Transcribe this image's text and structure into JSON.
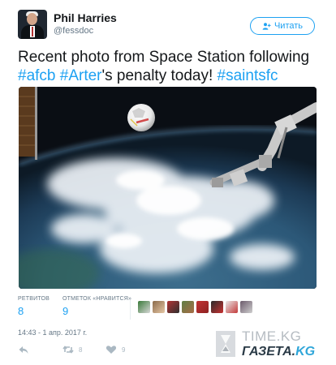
{
  "tweet": {
    "author_name": "Phil Harries",
    "author_handle": "@fessdoc",
    "follow_label": "Читать",
    "text_parts": {
      "p1": "Recent photo from Space Station following",
      "h1": "#afcb",
      "h2": "#Arter",
      "p2": "'s penalty today!",
      "h3": "#saintsfc"
    },
    "stats": {
      "retweets_label": "РЕТВИТОВ",
      "retweets_count": "8",
      "likes_label": "ОТМЕТОК «НРАВИТСЯ»",
      "likes_count": "9"
    },
    "timestamp": "14:43 - 1 апр. 2017 г.",
    "actions": {
      "retweet_count": "8",
      "like_count": "9"
    }
  },
  "watermark": {
    "site_top": "TIME.KG",
    "site_bottom_main": "ГАЗЕТА.",
    "site_bottom_tail": "KG"
  },
  "colors": {
    "accent": "#1da1f2",
    "muted": "#657786",
    "icon_gray": "#aab8c2"
  },
  "icons": [
    "follow-person-icon",
    "reply-icon",
    "retweet-icon",
    "like-heart-icon",
    "watermark-hourglass-icon"
  ]
}
